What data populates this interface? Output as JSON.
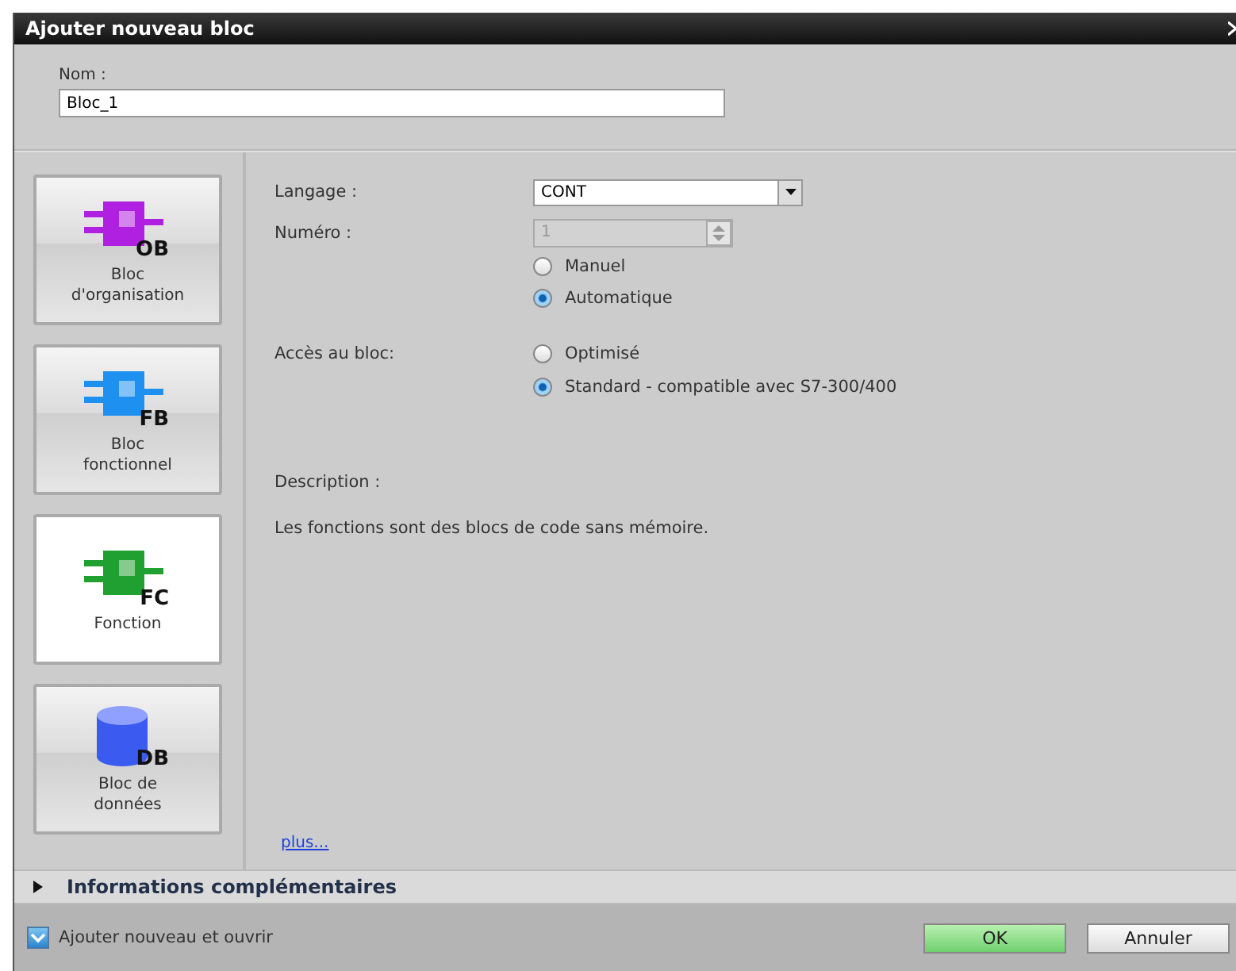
{
  "window": {
    "title": "Ajouter nouveau bloc"
  },
  "name_field": {
    "label": "Nom :",
    "value": "Bloc_1"
  },
  "block_types": [
    {
      "label": "Bloc\nd'organisation",
      "badge": "OB",
      "kind": "module",
      "color": "#b020e0",
      "selected": false
    },
    {
      "label": "Bloc\nfonctionnel",
      "badge": "FB",
      "kind": "module",
      "color": "#1e90f0",
      "selected": false
    },
    {
      "label": "Fonction",
      "badge": "FC",
      "kind": "module",
      "color": "#20a030",
      "selected": true
    },
    {
      "label": "Bloc de\ndonnées",
      "badge": "DB",
      "kind": "database",
      "color": "#3a5af0",
      "selected": false
    }
  ],
  "language": {
    "label": "Langage :",
    "value": "CONT"
  },
  "number": {
    "label": "Numéro :",
    "value": "1",
    "disabled": true,
    "modes": [
      {
        "label": "Manuel",
        "selected": false
      },
      {
        "label": "Automatique",
        "selected": true
      }
    ]
  },
  "access": {
    "label": "Accès au bloc:",
    "options": [
      {
        "label": "Optimisé",
        "selected": false
      },
      {
        "label": "Standard - compatible avec S7-300/400",
        "selected": true
      }
    ]
  },
  "description": {
    "label": "Description :",
    "text": "Les fonctions sont des blocs de code sans mémoire."
  },
  "more_link": "plus...",
  "additional_info": {
    "label": "Informations complémentaires",
    "expanded": false
  },
  "add_and_open": {
    "label": "Ajouter nouveau et ouvrir",
    "checked": true
  },
  "buttons": [
    {
      "label": "OK",
      "kind": "primary"
    },
    {
      "label": "Annuler",
      "kind": "secondary"
    }
  ]
}
